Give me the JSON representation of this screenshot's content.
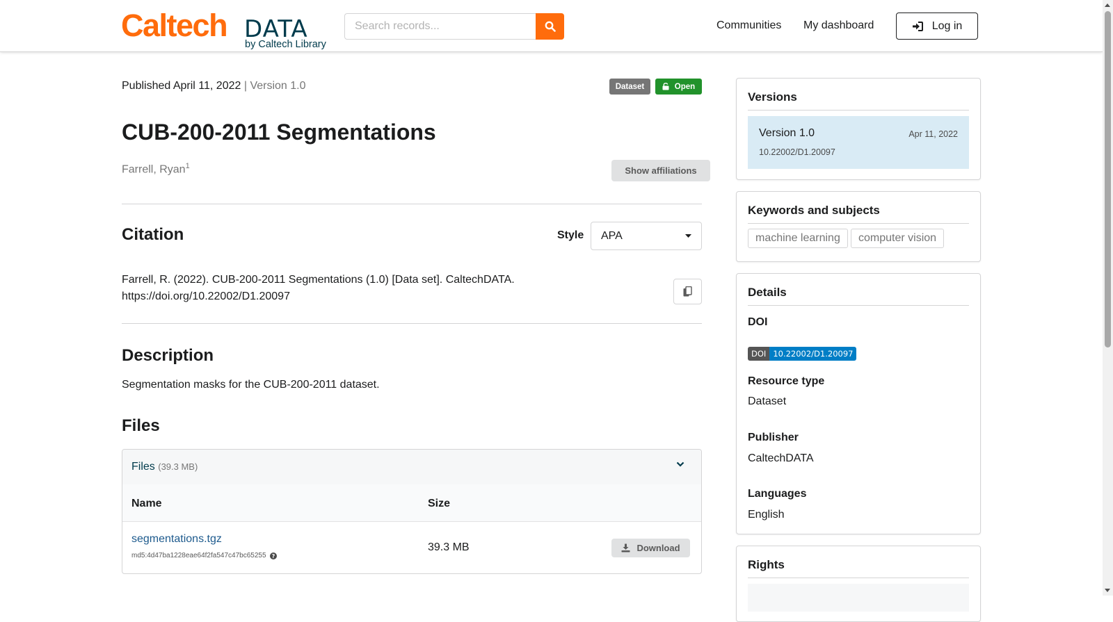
{
  "header": {
    "logo": {
      "primary": "Caltech",
      "secondary": "DATA",
      "tagline": "by Caltech Library"
    },
    "search": {
      "placeholder": "Search records...",
      "icon": "search-icon"
    },
    "nav": {
      "communities": "Communities",
      "dashboard": "My dashboard",
      "login": "Log in"
    }
  },
  "record": {
    "published": "Published April 11, 2022",
    "version": "| Version 1.0",
    "badges": {
      "type": "Dataset",
      "access": "Open"
    },
    "title": "CUB-200-2011 Segmentations",
    "creator": "Farrell, Ryan",
    "creator_affiliation_ref": "1",
    "show_affiliations": "Show affiliations"
  },
  "citation": {
    "heading": "Citation",
    "style_label": "Style",
    "style_value": "APA",
    "text_line1": "Farrell, R. (2022). CUB-200-2011 Segmentations (1.0) [Data set]. CaltechDATA.",
    "text_line2": "https://doi.org/10.22002/D1.20097"
  },
  "description": {
    "heading": "Description",
    "text": "Segmentation masks for the CUB-200-2011 dataset."
  },
  "files": {
    "heading": "Files",
    "panel_label": "Files",
    "panel_size": "(39.3 MB)",
    "columns": {
      "name": "Name",
      "size": "Size"
    },
    "rows": [
      {
        "name": "segmentations.tgz",
        "md5": "md5:4d47ba1228eae64f2fa547c47bc65255",
        "size": "39.3 MB",
        "action": "Download"
      }
    ]
  },
  "sidebar": {
    "versions": {
      "title": "Versions",
      "items": [
        {
          "name": "Version 1.0",
          "date": "Apr 11, 2022",
          "doi": "10.22002/D1.20097"
        }
      ]
    },
    "keywords": {
      "title": "Keywords and subjects",
      "tags": [
        "machine learning",
        "computer vision"
      ]
    },
    "details": {
      "title": "Details",
      "doi_label": "DOI",
      "doi_badge_key": "DOI",
      "doi_badge_value": "10.22002/D1.20097",
      "resource_type_label": "Resource type",
      "resource_type": "Dataset",
      "publisher_label": "Publisher",
      "publisher": "CaltechDATA",
      "languages_label": "Languages",
      "language": "English"
    },
    "rights": {
      "title": "Rights"
    }
  },
  "colors": {
    "brand_orange": "#ff6c0c",
    "brand_navy": "#003b4c",
    "open_green": "#21922b",
    "version_highlight": "#d9ebf5",
    "doi_blue": "#007ec6"
  }
}
